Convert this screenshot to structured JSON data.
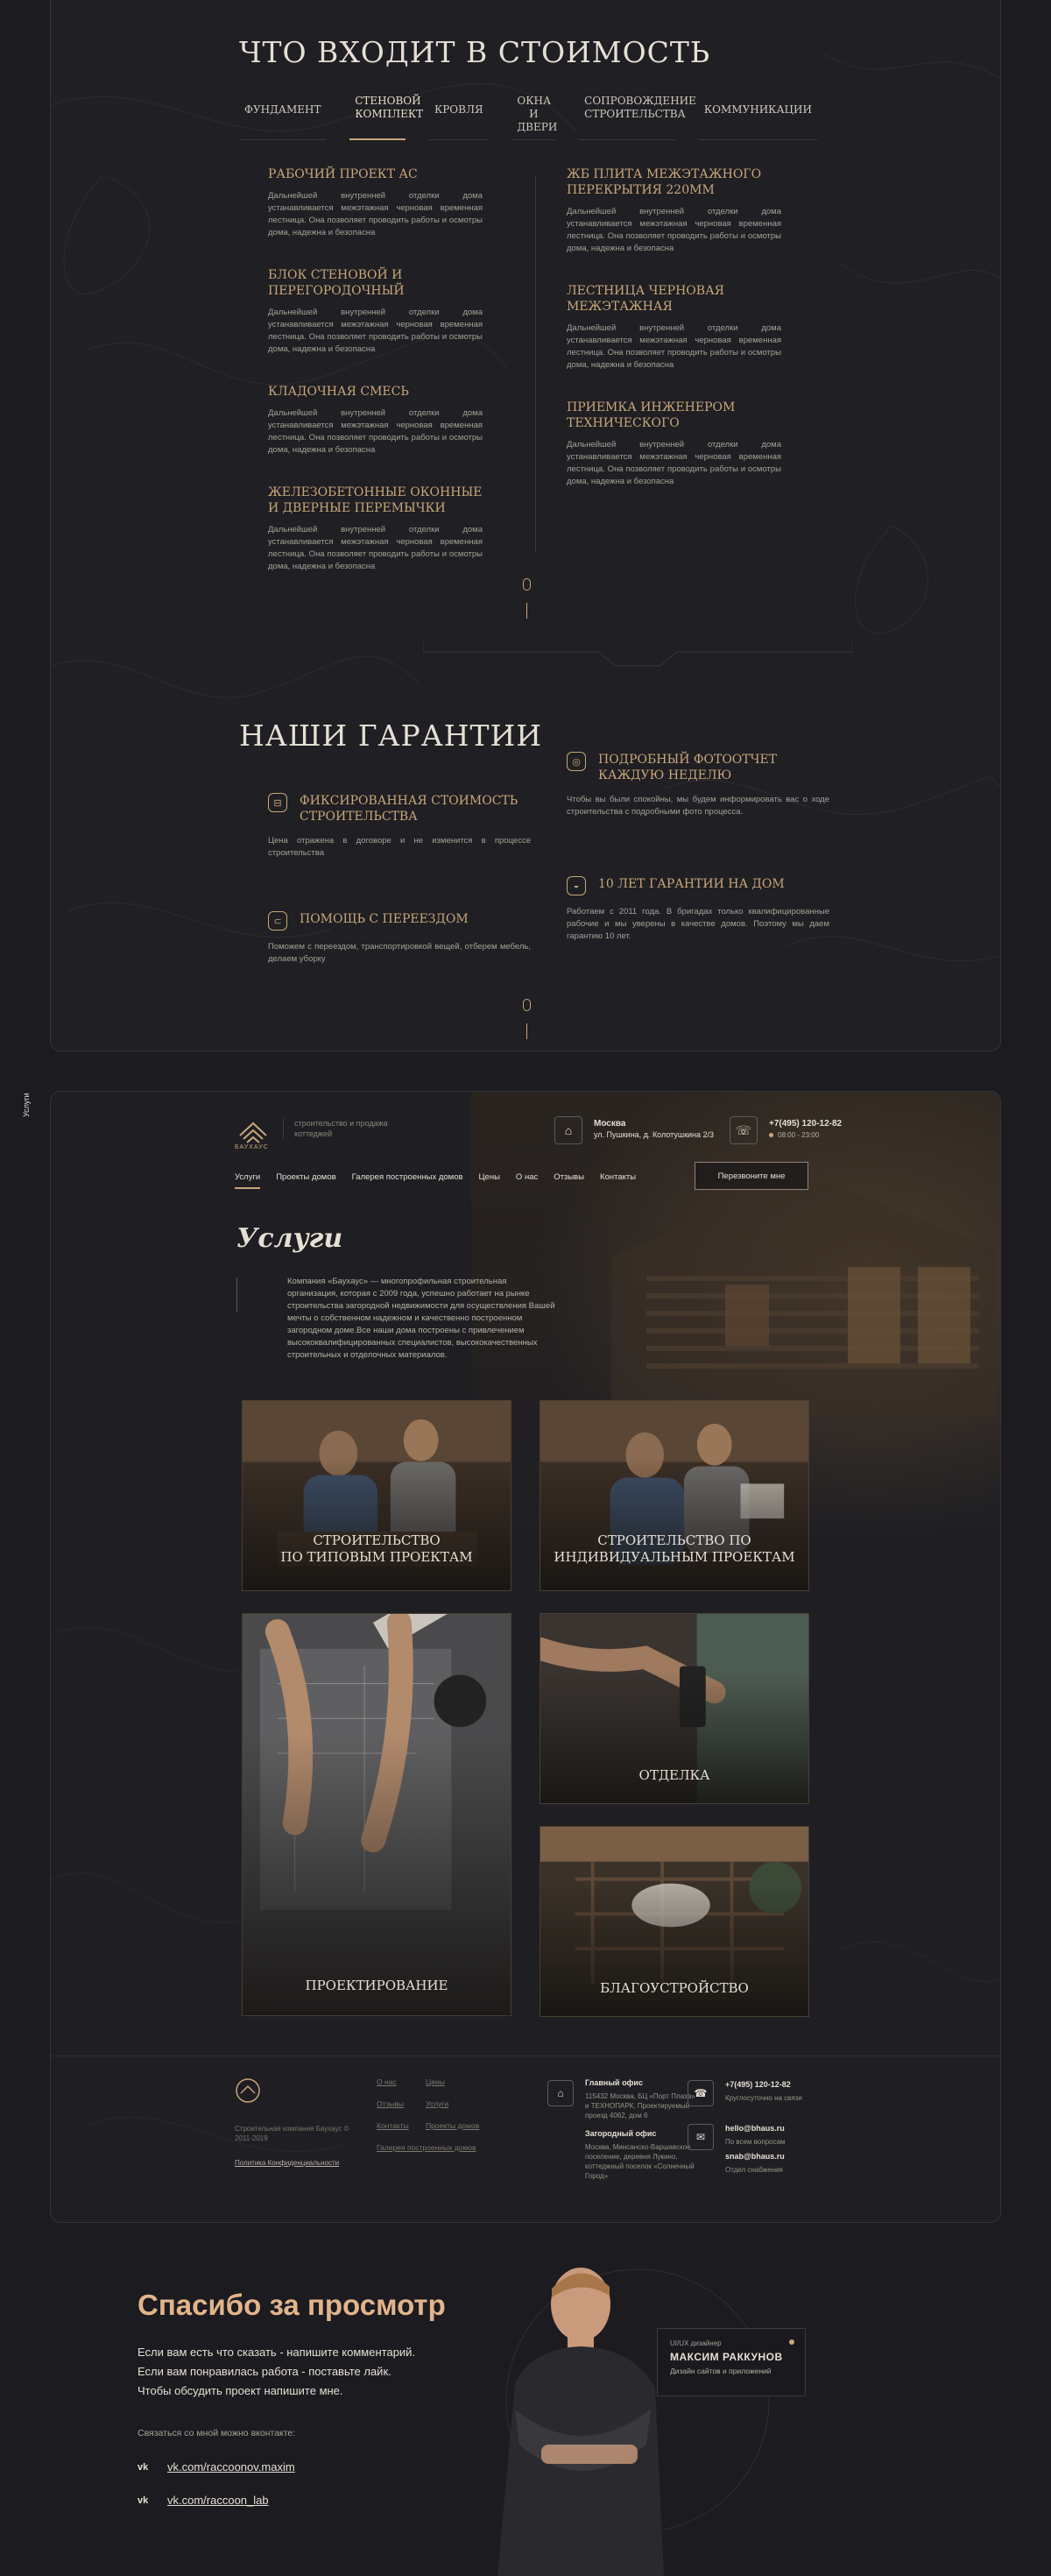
{
  "side_label": "Услуги",
  "included": {
    "title": "ЧТО ВХОДИТ В СТОИМОСТЬ",
    "tabs": [
      {
        "label": "ФУНДАМЕНТ"
      },
      {
        "label": "СТЕНОВОЙ КОМПЛЕКТ"
      },
      {
        "label": "КРОВЛЯ"
      },
      {
        "label": "ОКНА И ДВЕРИ"
      },
      {
        "label": "СОПРОВОЖДЕНИЕ СТРОИТЕЛЬСТВА"
      },
      {
        "label": "КОММУНИКАЦИИ"
      }
    ],
    "active_tab": "СТЕНОВОЙ КОМПЛЕКТ",
    "left_items": [
      {
        "title": "РАБОЧИЙ ПРОЕКТ АС",
        "text": "Дальнейшей внутренней отделки дома устанавливается межэтажная черновая временная лестница. Она позволяет проводить работы и осмотры дома, надежна и безопасна"
      },
      {
        "title": "БЛОК СТЕНОВОЙ И ПЕРЕГОРОДОЧНЫЙ",
        "text": "Дальнейшей внутренней отделки дома устанавливается межэтажная черновая временная лестница. Она позволяет проводить работы и осмотры дома, надежна и безопасна"
      },
      {
        "title": "КЛАДОЧНАЯ СМЕСЬ",
        "text": "Дальнейшей внутренней отделки дома устанавливается межэтажная черновая временная лестница. Она позволяет проводить работы и осмотры дома, надежна и безопасна"
      },
      {
        "title": "ЖЕЛЕЗОБЕТОННЫЕ ОКОННЫЕ И ДВЕРНЫЕ ПЕРЕМЫЧКИ",
        "text": "Дальнейшей внутренней отделки дома устанавливается межэтажная черновая временная лестница. Она позволяет проводить работы и осмотры дома, надежна и безопасна"
      }
    ],
    "right_items": [
      {
        "title": "ЖБ ПЛИТА МЕЖЭТАЖНОГО ПЕРЕКРЫТИЯ 220ММ",
        "text": "Дальнейшей внутренней отделки дома устанавливается межэтажная черновая временная лестница. Она позволяет проводить работы и осмотры дома, надежна и безопасна"
      },
      {
        "title": "ЛЕСТНИЦА ЧЕРНОВАЯ МЕЖЭТАЖНАЯ",
        "text": "Дальнейшей внутренней отделки дома устанавливается межэтажная черновая временная лестница. Она позволяет проводить работы и осмотры дома, надежна и безопасна"
      },
      {
        "title": "ПРИЕМКА ИНЖЕНЕРОМ ТЕХНИЧЕСКОГО",
        "text": "Дальнейшей внутренней отделки дома устанавливается межэтажная черновая временная лестница. Она позволяет проводить работы и осмотры дома, надежна и безопасна"
      }
    ]
  },
  "guarantees": {
    "title": "НАШИ ГАРАНТИИ",
    "items": [
      {
        "title": "ФИКСИРОВАННАЯ СТОИМОСТЬ СТРОИТЕЛЬСТВА",
        "text": "Цена отражена в договоре и не изменится в процессе строительства",
        "icon": "price-tag-icon"
      },
      {
        "title": "ПОМОЩЬ С ПЕРЕЕЗДОМ",
        "text": "Поможем с переездом, транспортировкой вещей, отберем мебель, делаем уборку",
        "icon": "moving-icon"
      },
      {
        "title": "ПОДРОБНЫЙ ФОТООТЧЕТ КАЖДУЮ НЕДЕЛЮ",
        "text": "Чтобы вы были спокойны, мы будем информировать вас о ходе строительства с подробными фото процесса.",
        "icon": "camera-icon"
      },
      {
        "title": "10 ЛЕТ ГАРАНТИИ НА ДОМ",
        "text": "Работаем с 2011 года. В бригадах только квалифицированные рабочие и мы уверены в качестве домов. Поэтому мы даем гарантию 10 лет.",
        "icon": "shield-icon"
      }
    ]
  },
  "site": {
    "logo_text": "БАУХАУС",
    "tagline": "строительство и продажа коттеджей",
    "city": "Москва",
    "address": "ул. Пушкина, д. Колотушкина 2/3",
    "phone": "+7(495) 120-12-82",
    "hours": "08:00 - 23:00",
    "nav": [
      "Услуги",
      "Проекты домов",
      "Галерея построенных домов",
      "Цены",
      "О нас",
      "Отзывы",
      "Контакты"
    ],
    "callback_label": "Перезвоните мне",
    "services_title": "Услуги",
    "services_desc": "Компания «Баухаус» — многопрофильная строительная организация, которая с 2009 года, успешно работает на рынке строительства загородной недвижимости для осуществления Вашей мечты о собственном надежном и качественно построенном загородном доме.Все наши дома построены с привлечением высококвалифицированных специалистов, высококачественных строительных и отделочных материалов.",
    "cards": [
      {
        "label_1": "СТРОИТЕЛЬСТВО",
        "label_2": "ПО ТИПОВЫМ ПРОЕКТАМ"
      },
      {
        "label_1": "СТРОИТЕЛЬСТВО ПО",
        "label_2": "ИНДИВИДУАЛЬНЫМ ПРОЕКТАМ"
      },
      {
        "label_1": "ПРОЕКТИРОВАНИЕ"
      },
      {
        "label_1": "ОТДЕЛКА"
      },
      {
        "label_1": "БЛАГОУСТРОЙСТВО"
      }
    ],
    "footer": {
      "copyright": "Строительная компания Баухаус © 2011-2019",
      "policy": "Политика Конфиденциальности",
      "links": [
        "О нас",
        "Цены",
        "Отзывы",
        "Услуги",
        "Контакты",
        "Проекты домов",
        "Галерея построенных домов"
      ],
      "office_title": "Главный офис",
      "office_text": "115432 Москва, БЦ «Порт Плаза» и ТЕХНОПАРК, Проектируемый проезд 4062, дом 6",
      "suburban_title": "Загородный офис",
      "suburban_text": "Москва, Минсанско-Варшавское поселение, деревня Лукино, коттеджный поселок «Солнечный Город»",
      "phone": "+7(495) 120-12-82",
      "phone_note": "Круглосуточно на связи",
      "email": "hello@bhaus.ru",
      "email_note": "По всем вопросам",
      "email2": "snab@bhaus.ru",
      "email2_note": "Отдел снабжения"
    }
  },
  "thanks": {
    "title": "Спасибо за просмотр",
    "lines": [
      "Если вам есть что сказать - напишите комментарий.",
      "Если вам понравилась работа - поставьте лайк.",
      "Чтобы обсудить проект напишите мне."
    ],
    "contact_label": "Связаться со мной можно вконтакте:",
    "vk_badge": "vk",
    "vk_links": [
      "vk.com/raccoonov.maxim",
      "vk.com/raccoon_lab"
    ],
    "designer_role": "UI/UX дизайнер",
    "designer_name": "МАКСИМ РАККУНОВ",
    "designer_sub": "Дизайн сайтов и приложений"
  }
}
